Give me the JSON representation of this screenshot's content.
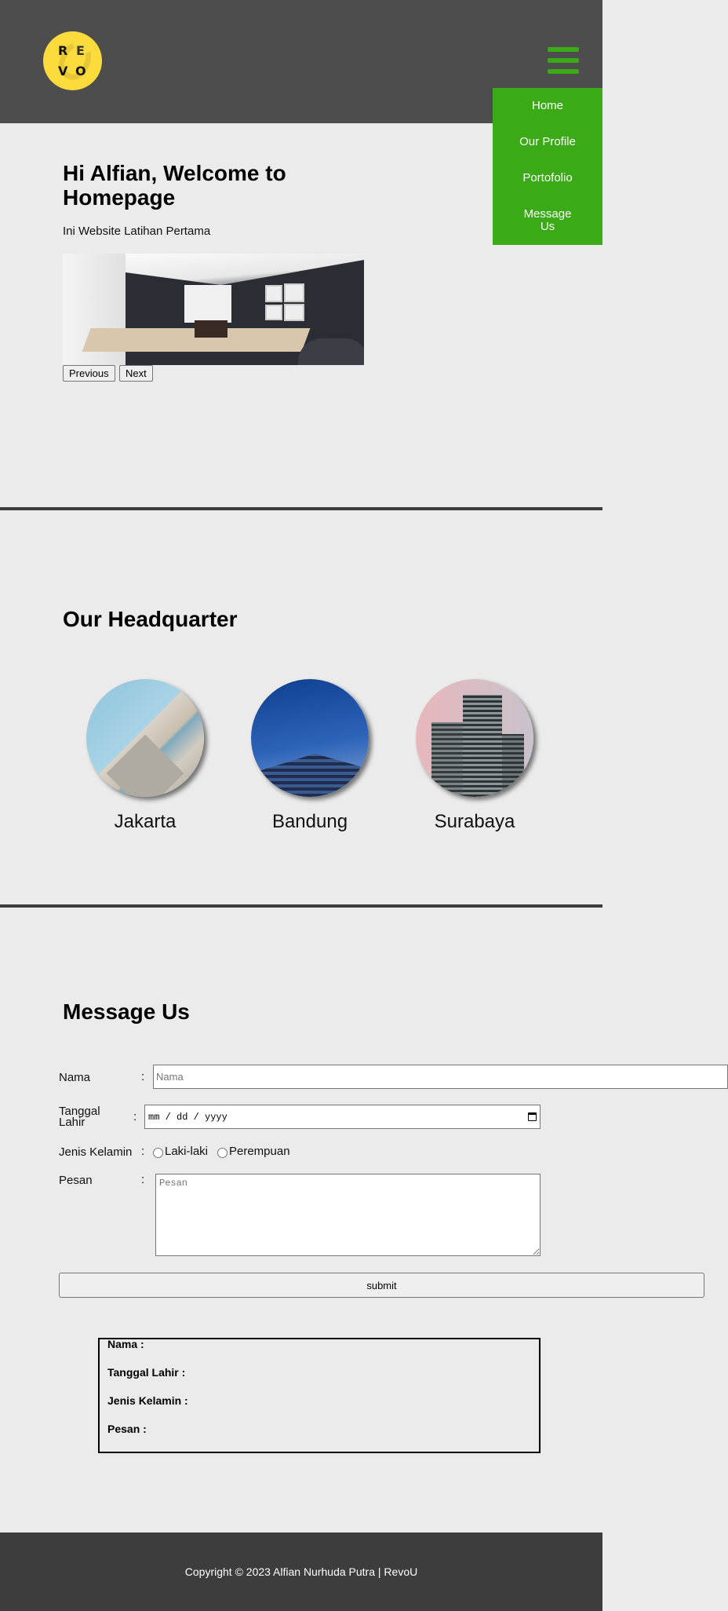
{
  "header": {
    "logo_letters": [
      "R",
      "E",
      "V",
      "O"
    ],
    "logo_alt": "RevoU logo",
    "menu_icon": "hamburger-icon",
    "nav": [
      {
        "label": "Home"
      },
      {
        "label": "Our Profile"
      },
      {
        "label": "Portofolio"
      },
      {
        "label": "Message Us"
      }
    ]
  },
  "colors": {
    "header_bg": "#4d4d4d",
    "accent_green": "#3aaa16",
    "page_bg": "#ebebeb",
    "footer_bg": "#3d3d3d",
    "logo_yellow": "#fcdc3c"
  },
  "hero": {
    "title": "Hi Alfian, Welcome to Homepage",
    "subtitle": "Ini Website Latihan Pertama",
    "slider": {
      "image": "modern office interior with desk and lamp",
      "prev_label": "Previous",
      "next_label": "Next"
    }
  },
  "headquarter": {
    "title": "Our Headquarter",
    "locations": [
      {
        "city": "Jakarta",
        "image": "angled office building facade with blue sky"
      },
      {
        "city": "Bandung",
        "image": "glass corner building against deep blue sky"
      },
      {
        "city": "Surabaya",
        "image": "high-rise towers against pink sky"
      }
    ]
  },
  "message": {
    "title": "Message Us",
    "fields": {
      "nama": {
        "label": "Nama",
        "placeholder": "Nama",
        "value": ""
      },
      "tanggal_lahir": {
        "label": "Tanggal Lahir",
        "placeholder": "mm / dd / yyyy",
        "value": ""
      },
      "jenis_kelamin": {
        "label": "Jenis Kelamin",
        "options": [
          "Laki-laki",
          "Perempuan"
        ],
        "selected": null
      },
      "pesan": {
        "label": "Pesan",
        "placeholder": "Pesan",
        "value": ""
      }
    },
    "colon": ":",
    "submit_label": "submit",
    "result": {
      "nama": "Nama :",
      "tanggal_lahir": "Tanggal Lahir :",
      "jenis_kelamin": "Jenis Kelamin :",
      "pesan": "Pesan :"
    }
  },
  "footer": {
    "text": "Copyright © 2023 Alfian Nurhuda Putra | RevoU"
  }
}
